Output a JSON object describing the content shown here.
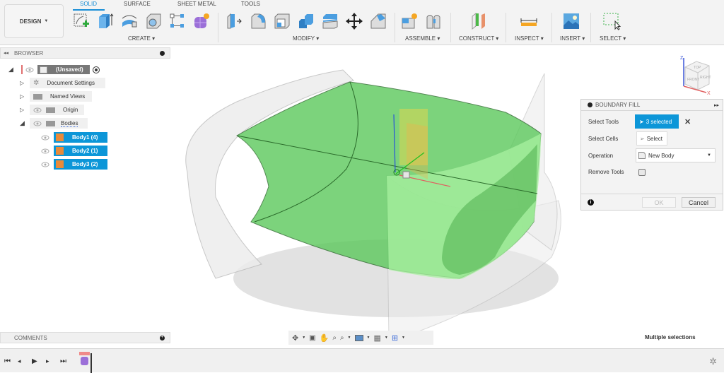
{
  "toolbar": {
    "workspace": "DESIGN",
    "tabs": [
      {
        "label": "SOLID",
        "active": true
      },
      {
        "label": "SURFACE",
        "active": false
      },
      {
        "label": "SHEET METAL",
        "active": false
      },
      {
        "label": "TOOLS",
        "active": false
      }
    ],
    "groups": [
      {
        "label": "CREATE",
        "tools": [
          "create-sketch",
          "extrude",
          "revolve",
          "hole",
          "pattern",
          "create-form"
        ]
      },
      {
        "label": "MODIFY",
        "tools": [
          "press-pull",
          "fillet",
          "shell",
          "combine",
          "offset-face",
          "move-copy",
          "chamfer"
        ]
      },
      {
        "label": "ASSEMBLE",
        "tools": [
          "new-component",
          "joint"
        ]
      },
      {
        "label": "CONSTRUCT",
        "tools": [
          "offset-plane"
        ]
      },
      {
        "label": "INSPECT",
        "tools": [
          "measure"
        ]
      },
      {
        "label": "INSERT",
        "tools": [
          "insert-image"
        ]
      },
      {
        "label": "SELECT",
        "tools": [
          "window-select"
        ]
      }
    ]
  },
  "browser": {
    "title": "BROWSER",
    "root": "(Unsaved)",
    "items": [
      {
        "label": "Document Settings",
        "icon": "gear-icon"
      },
      {
        "label": "Named Views",
        "icon": "folder-icon"
      },
      {
        "label": "Origin",
        "icon": "folder-icon"
      },
      {
        "label": "Bodies",
        "icon": "folder-icon"
      }
    ],
    "bodies": [
      {
        "label": "Body1 (4)"
      },
      {
        "label": "Body2 (1)"
      },
      {
        "label": "Body3 (2)"
      }
    ]
  },
  "dialog": {
    "title": "BOUNDARY FILL",
    "select_tools_label": "Select Tools",
    "select_tools_value": "3 selected",
    "select_cells_label": "Select Cells",
    "select_cells_value": "Select",
    "operation_label": "Operation",
    "operation_value": "New Body",
    "remove_tools_label": "Remove Tools",
    "remove_tools_checked": false,
    "ok_label": "OK",
    "cancel_label": "Cancel"
  },
  "viewcube": {
    "faces": [
      "TOP",
      "FRONT",
      "RIGHT"
    ],
    "axes": [
      "Z",
      "X"
    ]
  },
  "comments": {
    "title": "COMMENTS"
  },
  "status": {
    "text": "Multiple selections"
  },
  "colors": {
    "accent": "#0c96d8",
    "body_fill": "#5cc95c",
    "body_fill_light": "#a8f0a0"
  }
}
